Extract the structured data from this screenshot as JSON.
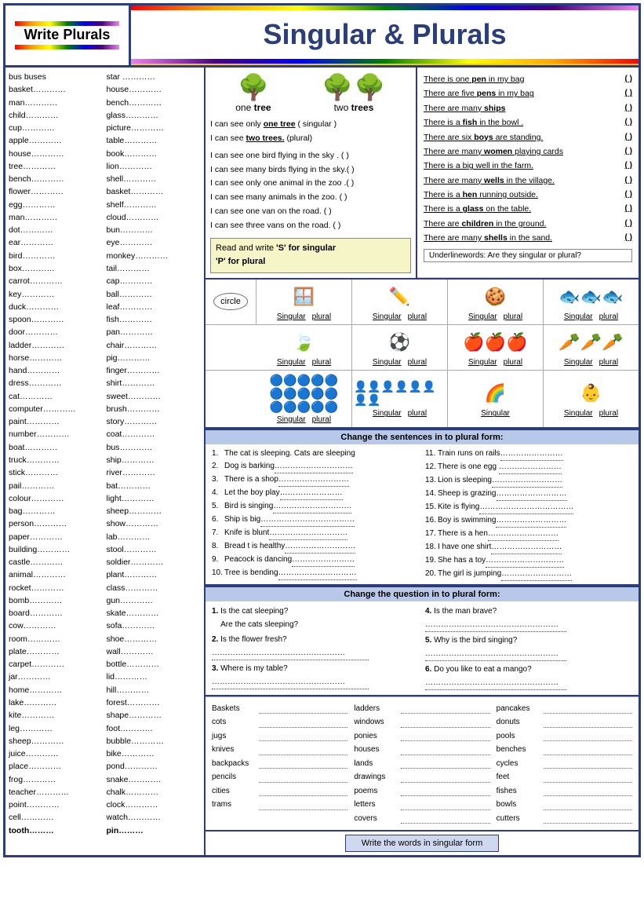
{
  "header": {
    "left_title": "Write Plurals",
    "right_title": "Singular & Plurals"
  },
  "word_list_col1": [
    "bus  buses",
    "basket…………",
    "man…………",
    "child…………",
    "cup…………",
    "apple…………",
    "house…………",
    "tree…………",
    "bench…………",
    "flower…………",
    "egg…………",
    "man…………",
    "dot…………",
    "ear…………",
    "bird…………",
    "box…………",
    "carrot…………",
    "key…………",
    "duck…………",
    "spoon…………",
    "door…………",
    "ladder…………",
    "horse…………",
    "hand…………",
    "dress…………",
    "cat…………",
    "computer…………",
    "paint…………",
    "number…………",
    "boat…………",
    "truck…………",
    "stick…………",
    "pail…………",
    "colour…………",
    "bag…………",
    "person…………",
    "paper…………",
    "building…………",
    "castle…………",
    "animal…………",
    "rocket…………",
    "bomb…………",
    "board…………",
    "cow…………",
    "room…………",
    "plate…………",
    "carpet…………",
    "jar…………",
    "home…………",
    "lake…………",
    "kite…………",
    "leg…………",
    "sheep…………",
    "juice…………",
    "place…………",
    "frog…………",
    "teacher…………",
    "point…………",
    "cell…………",
    "tooth………"
  ],
  "word_list_col2": [
    "star  …………",
    "house…………",
    "bench…………",
    "glass…………",
    "picture…………",
    "table…………",
    "book…………",
    "lion…………",
    "shell…………",
    "basket…………",
    "shelf…………",
    "cloud…………",
    "bun…………",
    "eye…………",
    "monkey…………",
    "tail…………",
    "cap…………",
    "ball…………",
    "leaf…………",
    "fish…………",
    "pan…………",
    "chair…………",
    "pig…………",
    "finger…………",
    "shirt…………",
    "sweet…………",
    "brush…………",
    "story…………",
    "coat…………",
    "bus…………",
    "ship…………",
    "river…………",
    "bat…………",
    "light…………",
    "sheep…………",
    "show…………",
    "lab…………",
    "stool…………",
    "soldier…………",
    "plant…………",
    "class…………",
    "gun…………",
    "skate…………",
    "sofa…………",
    "shoe…………",
    "wall…………",
    "bottle…………",
    "lid…………",
    "hill…………",
    "forest…………",
    "shape…………",
    "foot…………",
    "bubble…………",
    "bike…………",
    "pond…………",
    "snake…………",
    "chalk…………",
    "clock…………",
    "watch…………",
    "pin………"
  ],
  "tree_section": {
    "one_label": "one tree",
    "two_label": "two trees",
    "caption1": "I can see only one tree ( singular )",
    "caption2": "I can see two trees. (plural)",
    "sentences": [
      "I can see one bird flying in the sky .    (    )",
      "I can see many birds  flying in the sky.(    )",
      "I can see  only one animal in the zoo .(    )",
      "I can see many animals in the zoo.     (    )",
      "I can see one van on the road.          (    )",
      "I can see three vans on the road.       (    )"
    ],
    "box_title": "Read and write 'S' for singular",
    "box_title2": "'P' for plural"
  },
  "right_sentences": [
    "There is one pen in my bag        (    )",
    "There are five pens in my bag     (    )",
    "There are many ships              (    )",
    "There is a fish in the bowl .     (    )",
    "There are six boys are standing.  (    )",
    "There are many women playing cards(    )",
    "There is a  big well in the farm. (    )",
    "There are many wells in the village.(  )",
    "There is a hen running outside.   (    )",
    "There is a glass on the table.    (    )",
    "There are children in the ground. (    )",
    "There are many shells in the sand.(    )"
  ],
  "underline_words_label": "Underlinewords: Are they singular or plural?",
  "circle_section": {
    "header1": "Read and write 'S' for singular",
    "header2": "'P' for plural",
    "label": "circle",
    "items": [
      {
        "icon": "🪟",
        "label1": "Singular",
        "label2": "plural"
      },
      {
        "icon": "✏️",
        "label1": "Singular",
        "label2": "plural"
      },
      {
        "icon": "🍪",
        "label1": "Singular",
        "label2": "plural"
      },
      {
        "icon": "🐟",
        "label1": "Singular",
        "label2": "plural"
      },
      {
        "icon": "🍃",
        "label1": "Singular",
        "label2": "plural"
      },
      {
        "icon": "⚽",
        "label1": "Singular",
        "label2": "plural"
      },
      {
        "icon": "🍎",
        "label1": "Singular",
        "label2": "plural"
      },
      {
        "icon": "🥕",
        "label1": "Singular",
        "label2": "plural"
      },
      {
        "icon": "🔵",
        "label1": "Singular",
        "label2": "plural"
      },
      {
        "icon": "👥",
        "label1": "Singular",
        "label2": "plural"
      },
      {
        "icon": "🌈",
        "label1": "Singular",
        "label2": ""
      },
      {
        "icon": "👶",
        "label1": "Singular",
        "label2": "plural"
      }
    ]
  },
  "change_section": {
    "title": "Change the sentences in to plural form:"
  },
  "exercise_items": [
    "The cat is sleeping. Cats are sleeping",
    "Dog is barking…………………………………",
    "There is a shop………………………………",
    "Let the boy play…………………………………",
    "Bird is singing………………………………",
    "Ship is big…………………………………",
    "Knife is blunt…………………………………",
    "Bread t is healthy…………………………",
    "Peacock is dancing…………………………",
    "Tree is bending…………………………"
  ],
  "exercise_items_right": [
    "Train  runs on rails…………………………",
    "There is one egg …………………………",
    "Lion is sleeping…………………………",
    "Sheep is grazing…………………………",
    "Kite is flying…………………………",
    "Boy is swimming…………………………",
    "There is a hen…………………………",
    "I have  one shirt…………………………",
    "She has a toy…………………………",
    "The girl is jumping…………………………"
  ],
  "question_section": {
    "title": "Change the question in to plural form:",
    "items_left": [
      {
        "num": "1.",
        "q": "Is the cat sleeping?",
        "a": "Are the cats sleeping?"
      },
      {
        "num": "2.",
        "q": "Is the flower  fresh?",
        "a": ""
      },
      {
        "num": "3.",
        "q": "Where is my table?",
        "a": ""
      }
    ],
    "items_right": [
      {
        "num": "4.",
        "q": "Is the man brave?",
        "a": ""
      },
      {
        "num": "5.",
        "q": "Why is the bird singing?",
        "a": ""
      },
      {
        "num": "6.",
        "q": "Do you like to eat a mango?",
        "a": ""
      }
    ]
  },
  "bottom_words_col1": [
    "Baskets",
    "cots",
    "jugs",
    "knives",
    "backpacks",
    "pencils",
    "cities",
    "trams"
  ],
  "bottom_words_col2": [
    "ladders",
    "windows",
    "ponies",
    "houses",
    "lands",
    "drawings",
    "poems",
    "letters",
    "covers"
  ],
  "bottom_words_col3": [
    "pancakes",
    "donuts",
    "pools",
    "benches",
    "cycles",
    "feet",
    "fishes",
    "bowls",
    "cutters"
  ],
  "footer": {
    "label": "Write the words in singular form"
  },
  "colors": {
    "border": "#2c3e7a",
    "header_bg": "#b8c8e8",
    "accent": "#e8c840"
  }
}
